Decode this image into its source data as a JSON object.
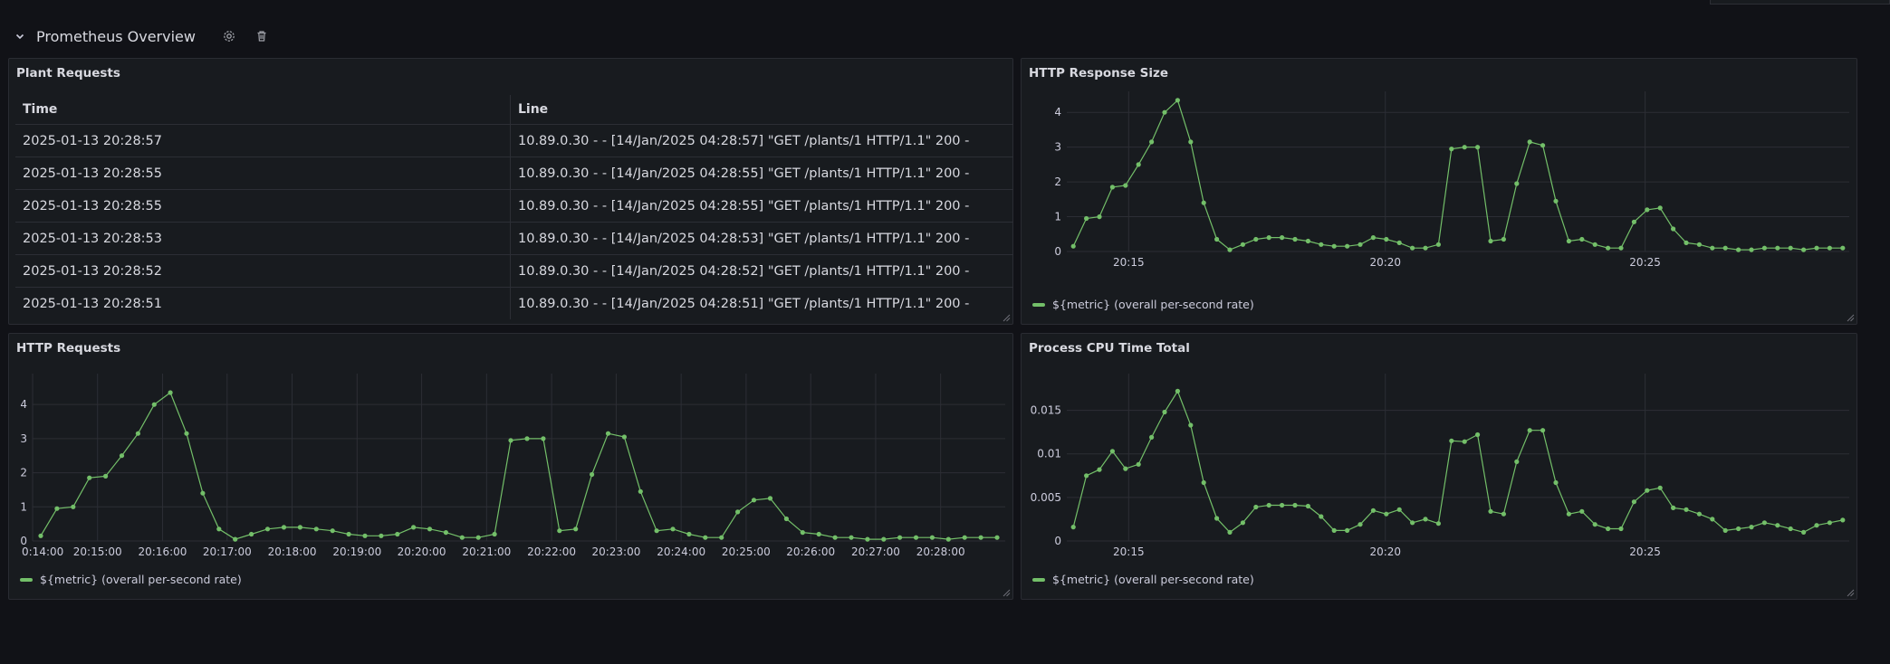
{
  "row": {
    "title": "Prometheus Overview",
    "collapse_icon": "chevron-down-icon",
    "settings_icon": "gear-icon",
    "delete_icon": "trash-icon"
  },
  "colors": {
    "background": "#111217",
    "panel": "#181b1f",
    "series": "#73bf69",
    "grid": "#2c2e35",
    "text": "#ccccdc"
  },
  "logs_panel": {
    "title": "Plant Requests",
    "columns": [
      "Time",
      "Line"
    ],
    "rows": [
      [
        "2025-01-13 20:28:57",
        "10.89.0.30 - - [14/Jan/2025 04:28:57] \"GET /plants/1 HTTP/1.1\" 200 -"
      ],
      [
        "2025-01-13 20:28:55",
        "10.89.0.30 - - [14/Jan/2025 04:28:55] \"GET /plants/1 HTTP/1.1\" 200 -"
      ],
      [
        "2025-01-13 20:28:55",
        "10.89.0.30 - - [14/Jan/2025 04:28:55] \"GET /plants/1 HTTP/1.1\" 200 -"
      ],
      [
        "2025-01-13 20:28:53",
        "10.89.0.30 - - [14/Jan/2025 04:28:53] \"GET /plants/1 HTTP/1.1\" 200 -"
      ],
      [
        "2025-01-13 20:28:52",
        "10.89.0.30 - - [14/Jan/2025 04:28:52] \"GET /plants/1 HTTP/1.1\" 200 -"
      ],
      [
        "2025-01-13 20:28:51",
        "10.89.0.30 - - [14/Jan/2025 04:28:51] \"GET /plants/1 HTTP/1.1\" 200 -"
      ]
    ]
  },
  "chart_data": [
    {
      "panel": "response_size",
      "title": "HTTP Response Size",
      "type": "line",
      "x_range": [
        20.23,
        20.483
      ],
      "xticks": [
        {
          "v": 20.25,
          "label": "20:15"
        },
        {
          "v": 20.333,
          "label": "20:20"
        },
        {
          "v": 20.417,
          "label": "20:25"
        }
      ],
      "yticks": [
        0,
        1,
        2,
        3,
        4
      ],
      "ylim": [
        0,
        4.5
      ],
      "grid": true,
      "legend": "bottom-left",
      "series": [
        {
          "name": "${metric} (overall per-second rate)",
          "values": [
            0.15,
            0.95,
            1.0,
            1.85,
            1.9,
            2.5,
            3.15,
            4.0,
            4.35,
            3.15,
            1.4,
            0.35,
            0.05,
            0.2,
            0.35,
            0.4,
            0.4,
            0.35,
            0.3,
            0.2,
            0.15,
            0.15,
            0.2,
            0.4,
            0.35,
            0.25,
            0.1,
            0.1,
            0.2,
            2.95,
            3.0,
            3.0,
            0.3,
            0.35,
            1.95,
            3.15,
            3.05,
            1.45,
            0.3,
            0.35,
            0.2,
            0.1,
            0.1,
            0.85,
            1.2,
            1.25,
            0.65,
            0.25,
            0.2,
            0.1,
            0.1,
            0.05,
            0.05,
            0.1,
            0.1,
            0.1,
            0.05,
            0.1,
            0.1,
            0.1
          ]
        }
      ]
    },
    {
      "panel": "http_requests",
      "title": "HTTP Requests",
      "type": "line",
      "x_range": [
        20.2333,
        20.4833
      ],
      "xticks": [
        {
          "v": 20.2333,
          "label": "0:14:00"
        },
        {
          "v": 20.25,
          "label": "20:15:00"
        },
        {
          "v": 20.2667,
          "label": "20:16:00"
        },
        {
          "v": 20.2833,
          "label": "20:17:00"
        },
        {
          "v": 20.3,
          "label": "20:18:00"
        },
        {
          "v": 20.3167,
          "label": "20:19:00"
        },
        {
          "v": 20.3333,
          "label": "20:20:00"
        },
        {
          "v": 20.35,
          "label": "20:21:00"
        },
        {
          "v": 20.3667,
          "label": "20:22:00"
        },
        {
          "v": 20.3833,
          "label": "20:23:00"
        },
        {
          "v": 20.4,
          "label": "20:24:00"
        },
        {
          "v": 20.4167,
          "label": "20:25:00"
        },
        {
          "v": 20.4333,
          "label": "20:26:00"
        },
        {
          "v": 20.45,
          "label": "20:27:00"
        },
        {
          "v": 20.4667,
          "label": "20:28:00"
        }
      ],
      "yticks": [
        0,
        1,
        2,
        3,
        4
      ],
      "ylim": [
        0,
        4.8
      ],
      "grid": true,
      "legend": "bottom-left",
      "series": [
        {
          "name": "${metric} (overall per-second rate)",
          "values": [
            0.15,
            0.95,
            1.0,
            1.85,
            1.9,
            2.5,
            3.15,
            4.0,
            4.35,
            3.15,
            1.4,
            0.35,
            0.05,
            0.2,
            0.35,
            0.4,
            0.4,
            0.35,
            0.3,
            0.2,
            0.15,
            0.15,
            0.2,
            0.4,
            0.35,
            0.25,
            0.1,
            0.1,
            0.2,
            2.95,
            3.0,
            3.0,
            0.3,
            0.35,
            1.95,
            3.15,
            3.05,
            1.45,
            0.3,
            0.35,
            0.2,
            0.1,
            0.1,
            0.85,
            1.2,
            1.25,
            0.65,
            0.25,
            0.2,
            0.1,
            0.1,
            0.05,
            0.05,
            0.1,
            0.1,
            0.1,
            0.05,
            0.1,
            0.1,
            0.1
          ]
        }
      ]
    },
    {
      "panel": "cpu_time",
      "title": "Process CPU Time Total",
      "type": "line",
      "x_range": [
        20.23,
        20.483
      ],
      "xticks": [
        {
          "v": 20.25,
          "label": "20:15"
        },
        {
          "v": 20.333,
          "label": "20:20"
        },
        {
          "v": 20.417,
          "label": "20:25"
        }
      ],
      "yticks": [
        {
          "v": 0,
          "label": "0"
        },
        {
          "v": 0.005,
          "label": "0.005"
        },
        {
          "v": 0.01,
          "label": "0.01"
        },
        {
          "v": 0.015,
          "label": "0.015"
        }
      ],
      "ylim": [
        0,
        0.0188
      ],
      "grid": true,
      "legend": "bottom-left",
      "series": [
        {
          "name": "${metric} (overall per-second rate)",
          "values": [
            0.0016,
            0.0075,
            0.0082,
            0.0103,
            0.0083,
            0.0088,
            0.0119,
            0.0148,
            0.0172,
            0.0133,
            0.0067,
            0.0026,
            0.001,
            0.0021,
            0.0039,
            0.0041,
            0.0041,
            0.0041,
            0.004,
            0.0028,
            0.0012,
            0.0012,
            0.0019,
            0.0035,
            0.0031,
            0.0036,
            0.0021,
            0.0025,
            0.002,
            0.0115,
            0.0114,
            0.0122,
            0.0034,
            0.0031,
            0.0091,
            0.0127,
            0.0127,
            0.0067,
            0.0031,
            0.0034,
            0.0019,
            0.0014,
            0.0014,
            0.0045,
            0.0058,
            0.0061,
            0.0038,
            0.0036,
            0.0031,
            0.0025,
            0.0012,
            0.0014,
            0.0016,
            0.0021,
            0.0018,
            0.0014,
            0.001,
            0.0018,
            0.0021,
            0.0024
          ]
        }
      ]
    }
  ]
}
